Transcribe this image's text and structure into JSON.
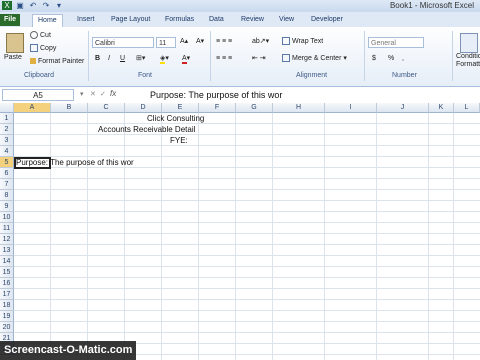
{
  "window_title": "Book1 - Microsoft Excel",
  "tabs": [
    "File",
    "Home",
    "Insert",
    "Page Layout",
    "Formulas",
    "Data",
    "Review",
    "View",
    "Developer"
  ],
  "ribbon": {
    "clipboard": {
      "paste": "Paste",
      "cut": "Cut",
      "copy": "Copy",
      "format_painter": "Format Painter",
      "label": "Clipboard"
    },
    "font": {
      "name": "Calibri",
      "size": "11",
      "label": "Font",
      "bold": "B",
      "italic": "I",
      "underline": "U"
    },
    "alignment": {
      "wrap": "Wrap Text",
      "merge": "Merge & Center",
      "label": "Alignment"
    },
    "number": {
      "format": "General",
      "currency": "$",
      "percent": "%",
      "comma": ",",
      "label": "Number"
    },
    "styles": {
      "conditional": "Conditional Formatting"
    }
  },
  "formula_bar": {
    "name_box": "A5",
    "fx": "fx",
    "content": "Purpose: The purpose of this wor"
  },
  "columns": [
    "A",
    "B",
    "C",
    "D",
    "E",
    "F",
    "G",
    "H",
    "I",
    "J",
    "K",
    "L"
  ],
  "rows": [
    "1",
    "2",
    "3",
    "4",
    "5",
    "6",
    "7",
    "8",
    "9",
    "10",
    "11",
    "12",
    "13",
    "14",
    "15",
    "16",
    "17",
    "18",
    "19",
    "20",
    "21",
    "22"
  ],
  "cells": {
    "title1": "Click Consulting",
    "title2": "Accounts Receivable Detail",
    "title3": "FYE:",
    "purpose": "Purpose: The purpose of this wor"
  },
  "watermark": "Screencast-O-Matic.com"
}
